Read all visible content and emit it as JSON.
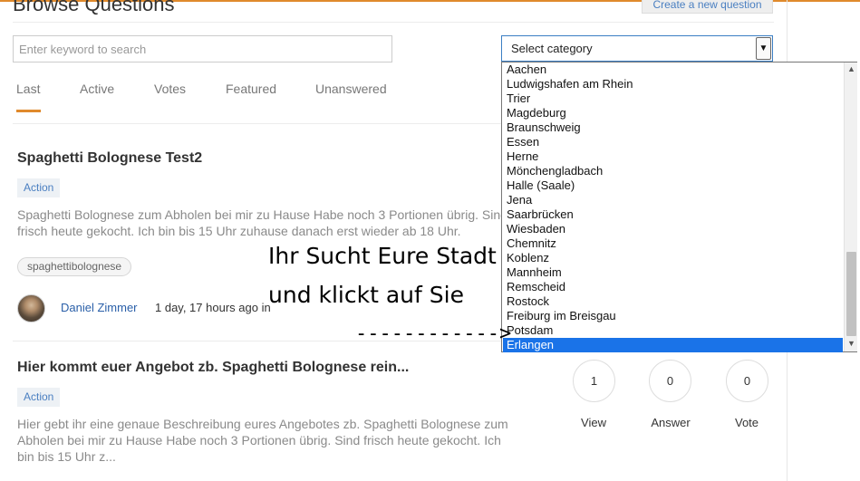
{
  "page": {
    "title": "Browse Questions",
    "create_button": "Create a new question",
    "accent_color": "#e08a2c"
  },
  "search": {
    "placeholder": "Enter keyword to search",
    "value": ""
  },
  "category_select": {
    "selected": "Select category",
    "options": [
      "Aachen",
      "Ludwigshafen am Rhein",
      "Trier",
      "Magdeburg",
      "Braunschweig",
      "Essen",
      "Herne",
      "Mönchengladbach",
      "Halle (Saale)",
      "Jena",
      "Saarbrücken",
      "Wiesbaden",
      "Chemnitz",
      "Koblenz",
      "Mannheim",
      "Remscheid",
      "Rostock",
      "Freiburg im Breisgau",
      "Potsdam",
      "Erlangen"
    ],
    "highlighted": "Erlangen",
    "highlight_color": "#1a73e8"
  },
  "tabs": [
    "Last",
    "Active",
    "Votes",
    "Featured",
    "Unanswered"
  ],
  "active_tab": "Last",
  "questions": [
    {
      "title": "Spaghetti Bolognese Test2",
      "badge": "Action",
      "description": "Spaghetti Bolognese zum Abholen bei mir zu Hause Habe noch 3 Portionen übrig. Sind frisch heute gekocht. Ich bin bis 15 Uhr zuhause danach erst wieder ab 18 Uhr.",
      "tag": "spaghettibolognese",
      "author": "Daniel Zimmer",
      "time": "1 day, 17 hours ago in"
    },
    {
      "title": "Hier kommt euer Angebot zb. Spaghetti Bolognese rein...",
      "badge": "Action",
      "description": "Hier gebt ihr eine genaue Beschreibung eures Angebotes zb. Spaghetti Bolognese zum Abholen bei mir zu Hause Habe noch 3 Portionen übrig. Sind frisch heute gekocht. Ich bin bis 15 Uhr z...",
      "stats": [
        {
          "value": "1",
          "label": "View"
        },
        {
          "value": "0",
          "label": "Answer"
        },
        {
          "value": "0",
          "label": "Vote"
        }
      ]
    }
  ],
  "annotation": {
    "line1": "Ihr Sucht Eure Stadt",
    "line2": "und klickt auf Sie",
    "arrow": "------------>"
  }
}
